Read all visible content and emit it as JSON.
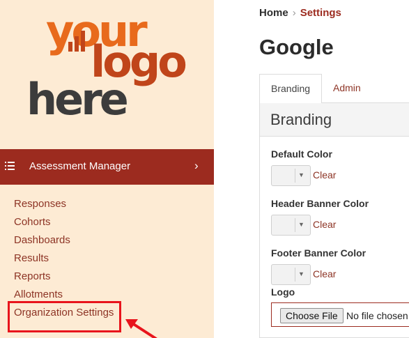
{
  "logo": {
    "line1": "your",
    "line2": "logo",
    "line3": "here"
  },
  "sidebar": {
    "header_label": "Assessment Manager",
    "items": [
      {
        "label": "Responses"
      },
      {
        "label": "Cohorts"
      },
      {
        "label": "Dashboards"
      },
      {
        "label": "Results"
      },
      {
        "label": "Reports"
      },
      {
        "label": "Allotments"
      },
      {
        "label": "Organization Settings",
        "highlighted": true
      }
    ]
  },
  "breadcrumb": {
    "home": "Home",
    "separator": "›",
    "current": "Settings"
  },
  "page": {
    "title": "Google"
  },
  "tabs": [
    {
      "label": "Branding",
      "active": true
    },
    {
      "label": "Admin",
      "active": false
    }
  ],
  "branding": {
    "heading": "Branding",
    "fields": [
      {
        "label": "Default Color",
        "clear_label": "Clear"
      },
      {
        "label": "Header Banner Color",
        "clear_label": "Clear"
      },
      {
        "label": "Footer Banner Color",
        "clear_label": "Clear"
      }
    ],
    "logo_label": "Logo",
    "file_button": "Choose File",
    "file_status": "No file chosen"
  },
  "colors": {
    "sidebar_bg": "#fdebd4",
    "nav_header_bg": "#9c2b1f",
    "link": "#8d3425",
    "highlight_border": "#e8141c",
    "accent": "#9c2b1f"
  }
}
